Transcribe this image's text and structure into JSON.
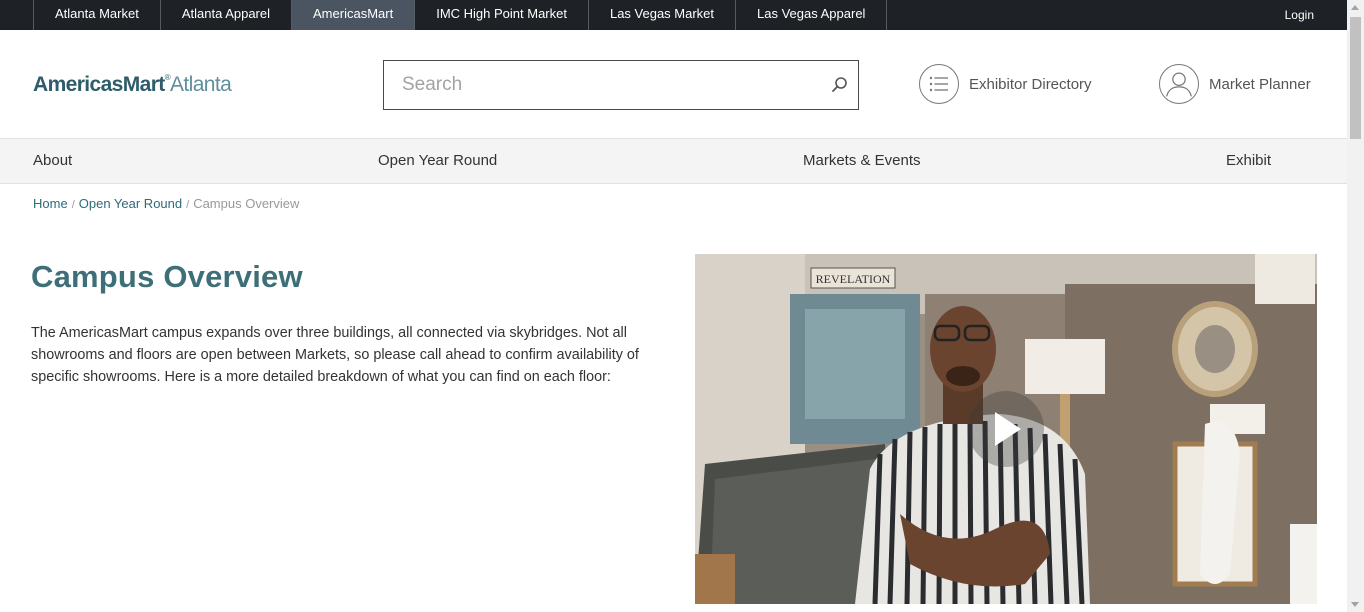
{
  "topbar": {
    "tabs": [
      {
        "label": "Atlanta Market"
      },
      {
        "label": "Atlanta Apparel"
      },
      {
        "label": "AmericasMart"
      },
      {
        "label": "IMC High Point Market"
      },
      {
        "label": "Las Vegas Market"
      },
      {
        "label": "Las Vegas Apparel"
      }
    ],
    "active_tab": "AmericasMart",
    "login_label": "Login"
  },
  "header": {
    "logo_brand": "AmericasMart",
    "logo_reg": "®",
    "logo_city": "Atlanta",
    "search_placeholder": "Search",
    "exhibitor_directory_label": "Exhibitor Directory",
    "market_planner_label": "Market Planner"
  },
  "nav": {
    "items": [
      {
        "label": "About"
      },
      {
        "label": "Open Year Round"
      },
      {
        "label": "Markets & Events"
      },
      {
        "label": "Exhibit"
      }
    ]
  },
  "breadcrumb": {
    "home": "Home",
    "separator": "/",
    "section": "Open Year Round",
    "current": "Campus Overview"
  },
  "content": {
    "title": "Campus Overview",
    "intro": "The AmericasMart campus expands over three buildings, all connected via skybridges. Not all showrooms and floors are open between Markets, so please call ahead to confirm availability of specific showrooms. Here is a more detailed breakdown of what you can find on each floor:"
  },
  "video": {
    "sign_text": "REVELATION"
  },
  "colors": {
    "topbar_bg": "#1e2226",
    "active_tab_bg": "#4a5561",
    "brand_teal": "#2d5c6b",
    "title_teal": "#3e6f78",
    "link_teal": "#2f6a7a"
  }
}
